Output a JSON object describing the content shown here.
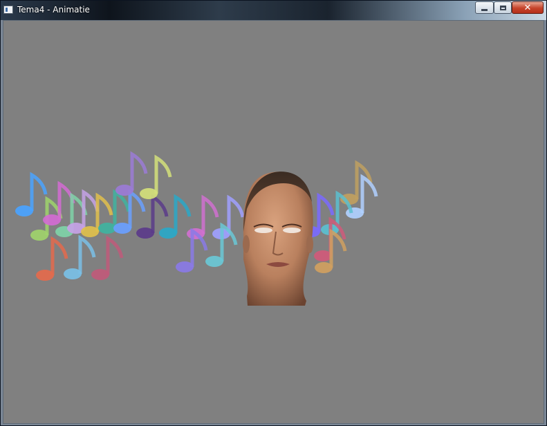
{
  "window": {
    "title": "Tema4 - Animatie",
    "icon": "app-window-icon",
    "controls": {
      "minimize_icon": "minimize-icon",
      "maximize_icon": "maximize-icon",
      "close_icon": "close-icon",
      "close_glyph": "✕"
    }
  },
  "scene": {
    "background_color": "#808080",
    "objects": [
      "music-notes",
      "head-model"
    ]
  }
}
